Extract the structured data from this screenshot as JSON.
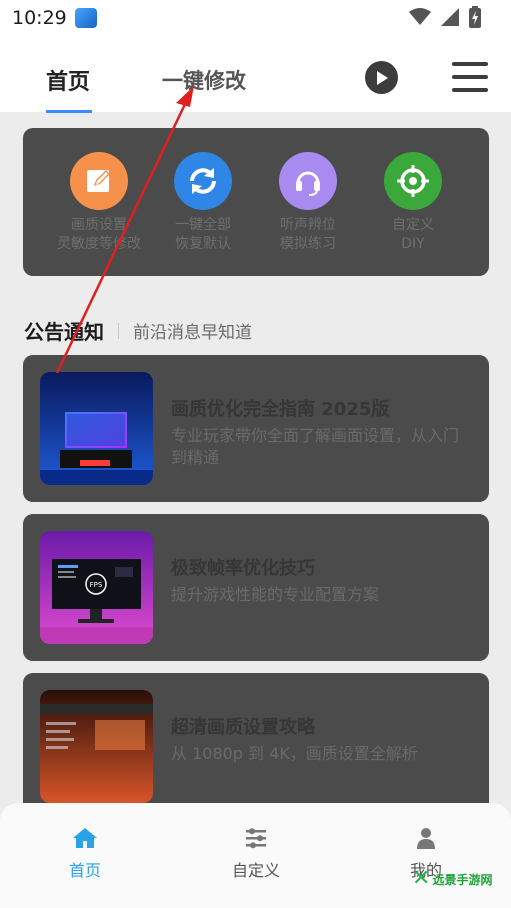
{
  "status": {
    "time": "10:29"
  },
  "tabs": {
    "home": "首页",
    "onekey": "一键修改"
  },
  "features": [
    {
      "line1": "画质设置",
      "line2": "灵敏度等修改",
      "icon": "edit-icon",
      "color": "#f6914b"
    },
    {
      "line1": "一键全部",
      "line2": "恢复默认",
      "icon": "refresh-icon",
      "color": "#2f86e6"
    },
    {
      "line1": "听声辨位",
      "line2": "模拟练习",
      "icon": "headset-icon",
      "color": "#a88af0"
    },
    {
      "line1": "自定义",
      "line2": "DIY",
      "icon": "crosshair-icon",
      "color": "#3aa83a"
    }
  ],
  "notice": {
    "title": "公告通知",
    "subtitle": "前沿消息早知道"
  },
  "articles": [
    {
      "title": "画质优化完全指南 2025版",
      "desc": "专业玩家带你全面了解画面设置，从入门到精通"
    },
    {
      "title": "极致帧率优化技巧",
      "desc": "提升游戏性能的专业配置方案",
      "thumb_text": "FPS"
    },
    {
      "title": "超清画质设置攻略",
      "desc": "从 1080p 到 4K，画质设置全解析"
    }
  ],
  "nav": {
    "home": "首页",
    "custom": "自定义",
    "mine": "我的"
  },
  "watermark": {
    "text": "远景手游网"
  },
  "colors": {
    "accent": "#3d8bfd",
    "nav_active": "#29a3e6",
    "annotation": "#e02020"
  }
}
